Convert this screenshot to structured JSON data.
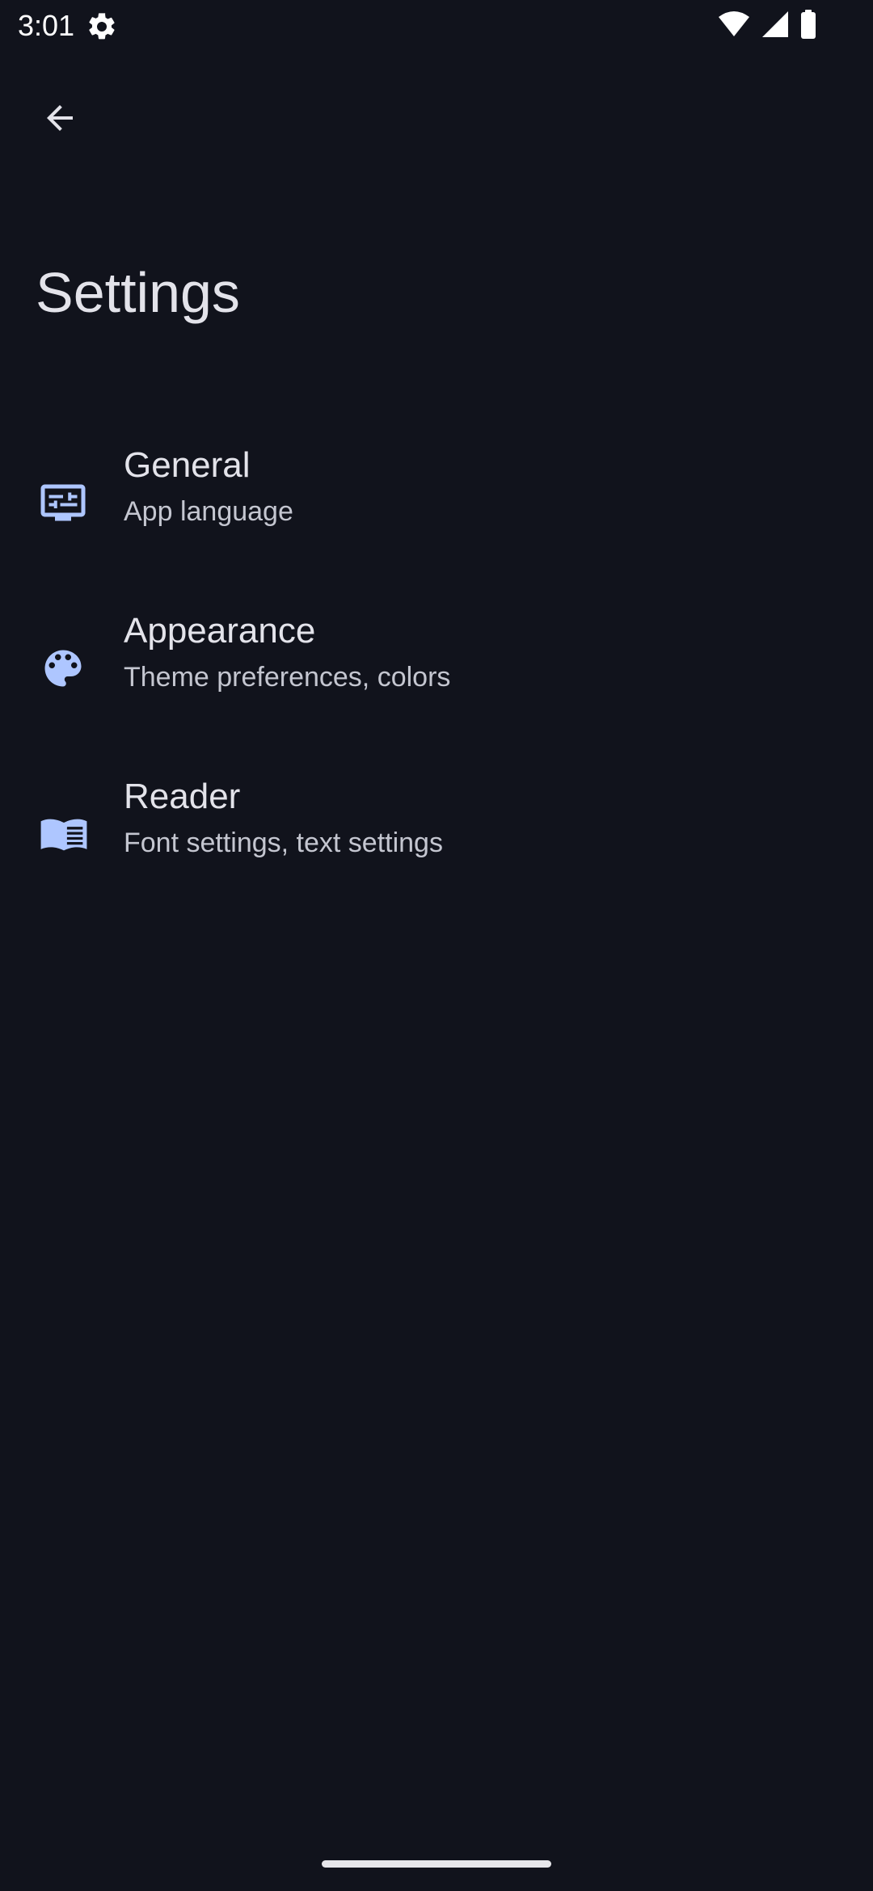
{
  "status_bar": {
    "time": "3:01"
  },
  "header": {
    "title": "Settings"
  },
  "settings": {
    "items": [
      {
        "icon": "tune-display-icon",
        "title": "General",
        "subtitle": "App language"
      },
      {
        "icon": "palette-icon",
        "title": "Appearance",
        "subtitle": "Theme preferences, colors"
      },
      {
        "icon": "book-icon",
        "title": "Reader",
        "subtitle": "Font settings, text settings"
      }
    ]
  },
  "colors": {
    "background": "#11131c",
    "accent_icon": "#aec6ff",
    "title_text": "#e3e3ea",
    "subtitle_text": "#c4c6d0"
  }
}
